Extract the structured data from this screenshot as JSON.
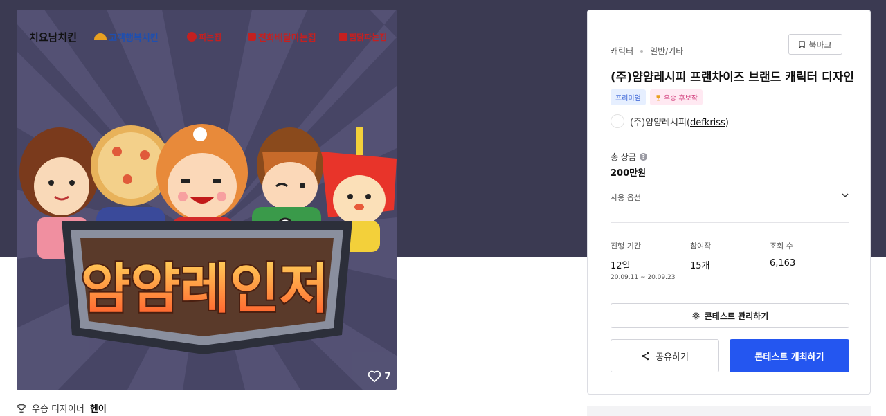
{
  "artwork": {
    "brand_logos": [
      {
        "text": "치요남치킨",
        "color": "#111111"
      },
      {
        "text": "고객행복치킨",
        "color": "#1e4fb0"
      },
      {
        "text": "피는집",
        "color": "#c42020"
      },
      {
        "text": "전화배달마는집",
        "color": "#c42020"
      },
      {
        "text": "찜닭파는집",
        "color": "#c42020"
      }
    ],
    "banner_title": "얌얌레인저",
    "like_count": "7"
  },
  "winner": {
    "label": "우승 디자이너",
    "name": "헨이"
  },
  "contest": {
    "category": "캐릭터",
    "subcategory": "일반/기타",
    "bookmark_label": "북마크",
    "title": "(주)얌얌레시피 프랜차이즈 브랜드 캐릭터 디자인",
    "badges": {
      "premium": "프리미엄",
      "candidate": "우승 후보작"
    },
    "host_name": "(주)얌얌레시피",
    "host_id": "defkriss",
    "prize_label": "총 상금",
    "prize_value": "200만원",
    "usage_label": "사용 옵션",
    "stats": {
      "period_label": "진행 기간",
      "period_value": "12일",
      "period_range": "20.09.11 ~ 20.09.23",
      "entries_label": "참여작",
      "entries_value": "15개",
      "views_label": "조회 수",
      "views_value": "6,163"
    },
    "manage_label": "콘테스트 관리하기",
    "share_label": "공유하기",
    "host_contest_label": "콘테스트 개최하기"
  },
  "colors": {
    "accent": "#2456f0",
    "band": "#3b3a52"
  }
}
